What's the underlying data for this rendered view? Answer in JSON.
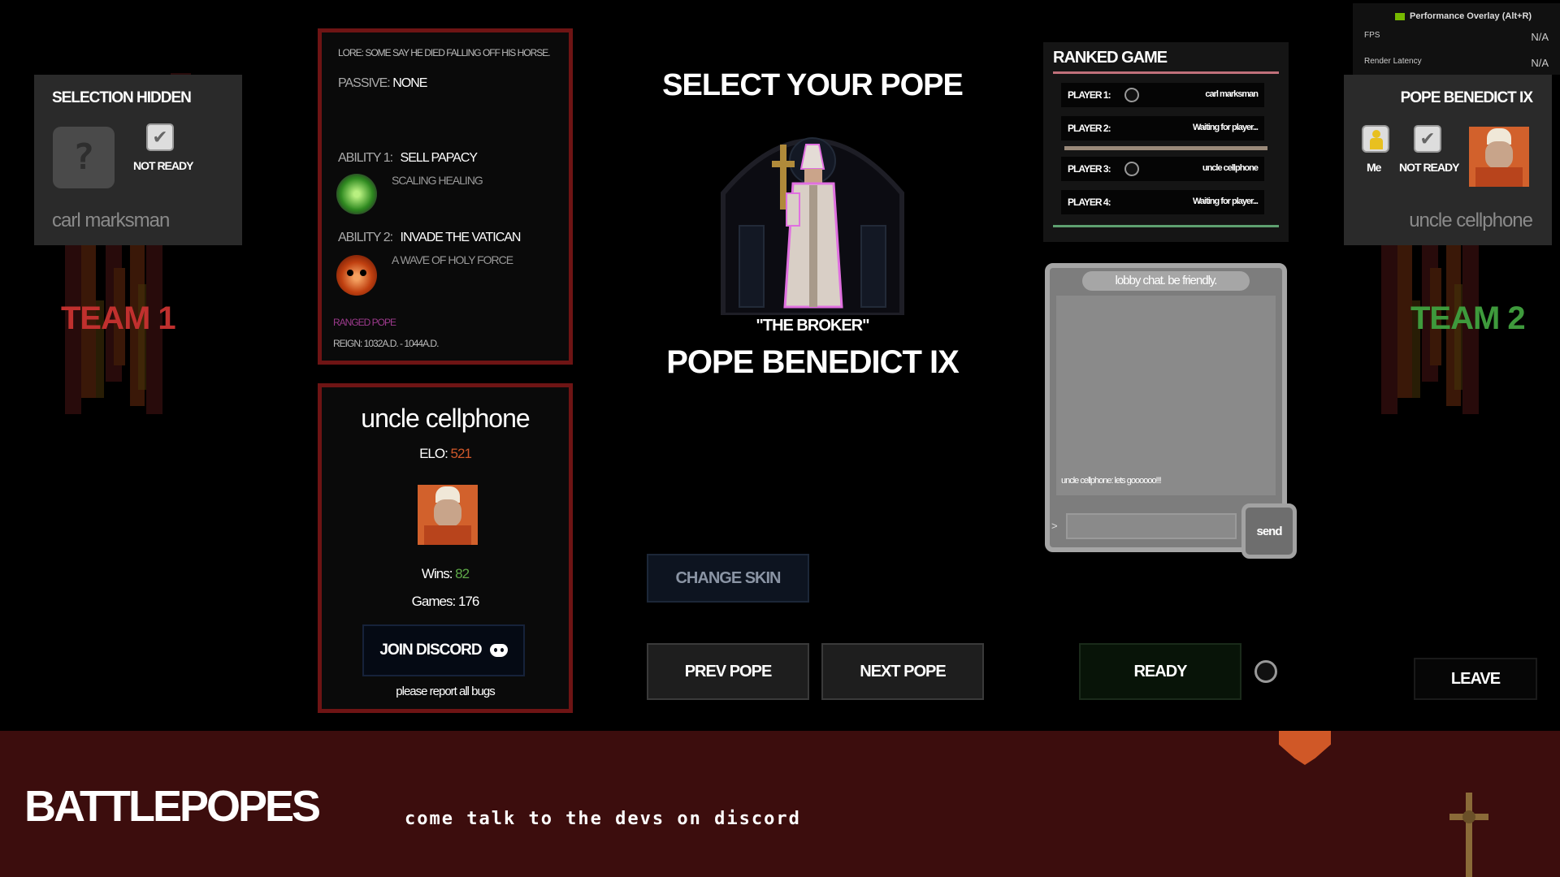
{
  "overlay": {
    "title": "Performance Overlay (Alt+R)",
    "rows": [
      {
        "label": "FPS",
        "value": "N/A"
      },
      {
        "label": "Render Latency",
        "value": "N/A"
      }
    ]
  },
  "left_player": {
    "header": "SELECTION HIDDEN",
    "avatar_glyph": "?",
    "ready_status": "NOT READY",
    "name": "carl marksman"
  },
  "right_player": {
    "header": "POPE BENEDICT IX",
    "me_label": "Me",
    "ready_status": "NOT READY",
    "name": "uncle cellphone"
  },
  "teams": {
    "team1": "TEAM 1",
    "team2": "TEAM 2",
    "team1_color": "#c0302e",
    "team2_color": "#3e9a3c"
  },
  "pope_info": {
    "lore": "LORE: SOME SAY HE DIED FALLING OFF HIS HORSE.",
    "passive_label": "PASSIVE:",
    "passive_value": "NONE",
    "ability1_label": "ABILITY 1:",
    "ability1_name": "SELL PAPACY",
    "ability1_desc": "SCALING HEALING",
    "ability1_icon": "green-gem-icon",
    "ability2_label": "ABILITY 2:",
    "ability2_name": "INVADE THE VATICAN",
    "ability2_desc": "A WAVE OF HOLY FORCE",
    "ability2_icon": "fire-skull-icon",
    "class": "RANGED POPE",
    "reign": "REIGN: 1032A.D. - 1044A.D."
  },
  "profile": {
    "name": "uncle cellphone",
    "elo_label": "ELO:",
    "elo": "521",
    "wins_label": "Wins:",
    "wins": "82",
    "games_label": "Games:",
    "games": "176",
    "discord_button": "JOIN DISCORD",
    "bugs_note": "please report all bugs"
  },
  "center": {
    "title": "SELECT YOUR POPE",
    "nickname": "\"THE BROKER\"",
    "pope_name": "POPE BENEDICT IX",
    "change_skin": "CHANGE SKIN",
    "prev": "PREV POPE",
    "next": "NEXT POPE"
  },
  "ranked": {
    "title": "RANKED GAME",
    "players": [
      {
        "label": "PLAYER 1:",
        "value": "carl marksman",
        "dot": true
      },
      {
        "label": "PLAYER 2:",
        "value": "Waiting for player...",
        "dot": false
      },
      {
        "label": "PLAYER 3:",
        "value": "uncle cellphone",
        "dot": true
      },
      {
        "label": "PLAYER 4:",
        "value": "Waiting for player...",
        "dot": false
      }
    ]
  },
  "chat": {
    "header": "lobby chat. be friendly.",
    "messages": [
      "uncle cellphone: lets goooooo!!!"
    ],
    "prompt": ">",
    "send": "send"
  },
  "actions": {
    "ready": "READY",
    "leave": "LEAVE"
  },
  "footer": {
    "logo": "BATTLEPOPES",
    "marquee": "come talk to the devs on discord"
  }
}
